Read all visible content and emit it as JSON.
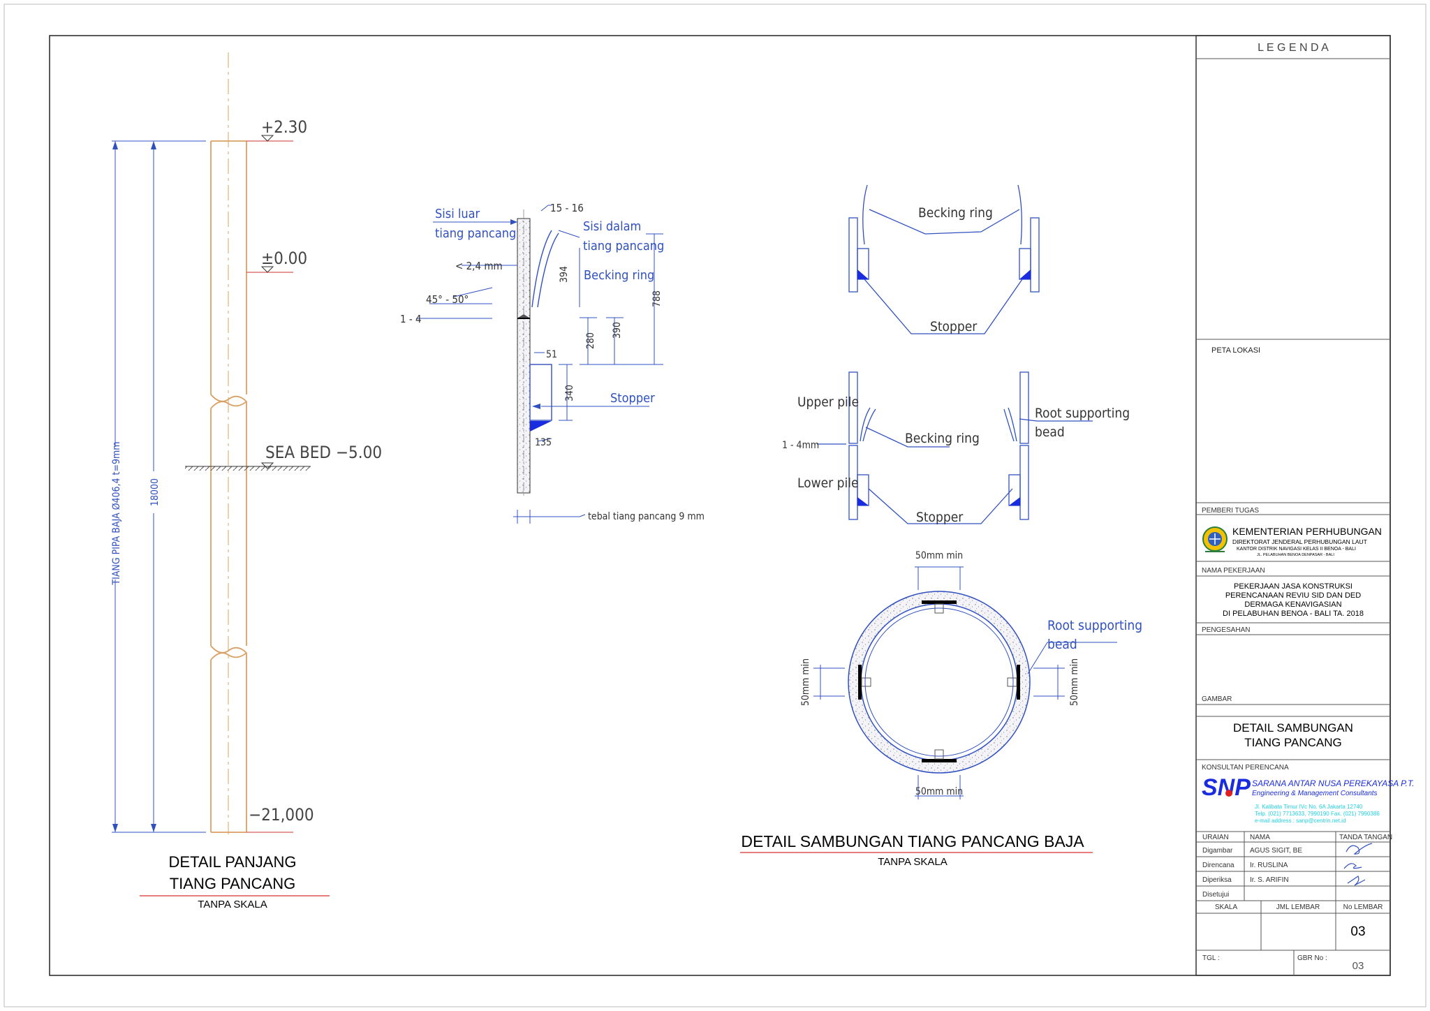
{
  "long_detail": {
    "elev_top": "+2.30",
    "elev_zero": "±0.00",
    "elev_seabed": "SEA BED  −5.00",
    "elev_bottom": "−21,000",
    "dim_total": "18000",
    "pipe_label": "TIANG PIPA BAJA Ø406,4  t=9mm",
    "title_line1": "DETAIL PANJANG",
    "title_line2": "TIANG PANCANG",
    "subtitle": "TANPA SKALA"
  },
  "section_detail": {
    "outer_side_1": "Sisi luar",
    "outer_side_2": "tiang pancang",
    "inner_side_1": "Sisi dalam",
    "inner_side_2": "tiang pancang",
    "dim_15_16": "15 - 16",
    "dim_24": "< 2,4 mm",
    "angle": "45° - 50°",
    "dim_1_4": "1 - 4",
    "dim_394": "394",
    "becking_ring": "Becking ring",
    "dim_788": "788",
    "dim_280": "280",
    "dim_390": "390",
    "dim_51": "51",
    "dim_340": "340",
    "stopper": "Stopper",
    "dim_135": "135",
    "thickness": "tebal tiang pancang 9 mm"
  },
  "joint_top": {
    "becking_ring": "Becking ring",
    "stopper": "Stopper"
  },
  "joint_mid": {
    "upper_pile": "Upper pile",
    "lower_pile": "Lower pile",
    "dim_1_4mm": "1 - 4mm",
    "becking_ring": "Becking ring",
    "root_1": "Root supporting",
    "root_2": "bead",
    "stopper": "Stopper"
  },
  "joint_circle": {
    "min_top": "50mm min",
    "min_bottom": "50mm min",
    "min_left": "50mm min",
    "min_right": "50mm min",
    "root_1": "Root supporting",
    "root_2": "bead"
  },
  "joint_title": {
    "title": "DETAIL  SAMBUNGAN TIANG PANCANG BAJA",
    "subtitle": "TANPA SKALA"
  },
  "title_block": {
    "legenda": "L E G E N D A",
    "peta_lokasi": "PETA  LOKASI",
    "pemberi_tugas": "PEMBERI  TUGAS",
    "ministry": "KEMENTERIAN PERHUBUNGAN",
    "directorate": "DIREKTORAT JENDERAL PERHUBUNGAN LAUT",
    "office": "KANTOR DISTRIK NAVIGASI KELAS II BENOA - BALI",
    "address": "JL. PELABUHAN BENOA  DENPASAR - BALI",
    "nama_pekerjaan": "NAMA  PEKERJAAN",
    "job_1": "PEKERJAAN JASA KONSTRUKSI",
    "job_2": "PERENCANAAN REVIU SID DAN DED",
    "job_3": "DERMAGA KENAVIGASIAN",
    "job_4": "DI PELABUHAN BENOA - BALI TA. 2018",
    "pengesahan": "PENGESAHAN",
    "gambar": "GAMBAR",
    "drawing_1": "DETAIL SAMBUNGAN",
    "drawing_2": "TIANG PANCANG",
    "konsultan": "KONSULTAN  PERENCANA",
    "logo_text": "SNP",
    "consultant_name": "SARANA ANTAR NUSA PEREKAYASA P.T.",
    "consultant_sub": "Engineering & Management Consultants",
    "consultant_addr1": "Jl. Kalibata Timur IVc No. 6A  Jakarta  12740",
    "consultant_addr2": "Telp. (021) 7713633, 7990190  Fax. (021) 7990386",
    "consultant_addr3": "e-mail address : sanp@centrin.net.id",
    "col_uraian": "URAIAN",
    "col_nama": "NAMA",
    "col_tanda": "TANDA  TANGAN",
    "rows": [
      {
        "role": "Digambar",
        "name": "AGUS  SIGIT,  BE"
      },
      {
        "role": "Direncana",
        "name": "Ir.  RUSLINA"
      },
      {
        "role": "Diperiksa",
        "name": "Ir.  S.  ARIFIN"
      },
      {
        "role": "Disetujui",
        "name": ""
      }
    ],
    "skala": "SKALA",
    "jml_lembar": "JML  LEMBAR",
    "no_lembar": "No  LEMBAR",
    "no_lembar_val": "03",
    "tgl": "TGL  :",
    "gbr_no": "GBR  No  :",
    "gbr_no_val": "03"
  }
}
